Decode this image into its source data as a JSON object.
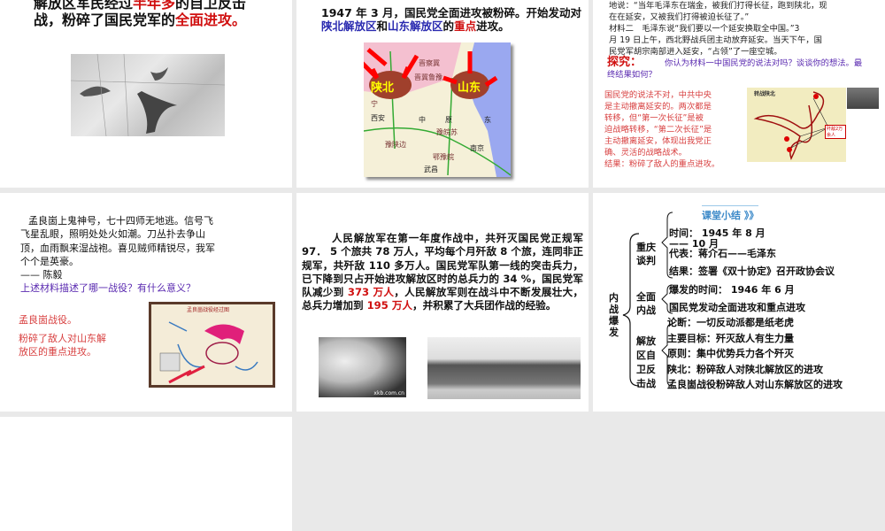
{
  "slides": [
    {
      "line1_a": "解放区军民经过",
      "line1_red": "半年多",
      "line1_b": "的自卫反击",
      "line2_a": "战，粉碎了国民党军的",
      "line2_red": "全面进攻。",
      "image": "war-map-grayscale"
    },
    {
      "line1": "1947 年 3 月，国民党全面进攻被粉碎。开始发动对",
      "p1": "陕北解放区",
      "p2": "和",
      "p3": "山东解放区",
      "p4": "的",
      "p5": "重点",
      "p6": "进攻。",
      "map_labels": {
        "shanbei": "陕北",
        "shandong": "山东",
        "jinchaji": "晋察冀",
        "jijiluyu": "晋冀鲁豫",
        "xian": "西安",
        "zhong": "中",
        "yuan": "原",
        "dong": "东",
        "yuwansu": "豫皖苏",
        "yushaanbian": "豫陕边",
        "eyuwan": "鄂豫皖",
        "nanjing": "南京",
        "wuchang": "武昌",
        "ning": "宁"
      }
    },
    {
      "lines": [
        "地说：“当年毛泽东在瑞金，被我们打得长征，跑到陕北，现",
        "在在延安，又被我们打得被迫长征了。”",
        "材料二　毛泽东说“我们要以一个延安换取全中国。”3",
        "月 19 日上午，西北野战兵团主动放弃延安。当天下午，国",
        "民党军胡宗南部进入延安，“占领”了一座空城。"
      ],
      "explore_label": "探究：",
      "question": "你认为材料一中国民党的说法对吗？谈谈你的想法。最终结果如何？",
      "answer": [
        "国民党的说法不对，中共中央",
        "是主动撤离延安的。两次都是",
        "转移，但“第一次长征”是被",
        "迫战略转移，“第二次长征”是",
        "主动撤离延安，体现出我党正",
        "确、灵活的战略战术。",
        "结果：粉碎了敌人的重点进攻。"
      ],
      "map_title": "转战陕北",
      "map_tag": "歼敌2万余人"
    },
    {
      "poem": [
        "孟良崮上鬼神号，七十四师无地逃。信号飞",
        "飞星乱眼，照明处处火如潮。刀丛扑去争山",
        "顶，血雨飘来湿战袍。喜见贼师精锐尽，我军",
        "个个是英豪。",
        "—— 陈毅"
      ],
      "question": "上述材料描述了哪一战役？有什么意义？",
      "answer1": "孟良崮战役。",
      "answer2": [
        "粉碎了敌人对山东解",
        "放区的重点进攻。"
      ],
      "map_title": "孟良崮战役经过图"
    },
    {
      "t1": "人民解放军在第一年度作战中，共歼灭国民党正规军 97． 5 个旅共 78 万人，平均每个月歼敌 8 个旅，连同非正规军，共歼敌 110 多万人。国民党军队第一线的突击兵力，已下降到只占开始进攻解放区时的总兵力的 34 %，国民党军队减少到 ",
      "r1": "373 万人",
      "t2": "，人民解放军则在战斗中不断发展壮大，总兵力增加到 ",
      "r2": "195 万人",
      "t3": "，并积累了大兵团作战的经验。",
      "watermark": "xkb.com.cn"
    },
    {
      "title": "课堂小结",
      "chev": "》》",
      "root": "内战爆发",
      "b1": "重庆谈判",
      "b1_items": [
        "时间： 1945 年 8 月—— 10 月",
        "代表：蒋介石——毛泽东",
        "结果：签署《双十协定》召开政协会议"
      ],
      "b2": "全面内战",
      "b2_items": [
        "爆发的时间： 1946 年 6 月",
        "国民党发动全面进攻和重点进攻"
      ],
      "b3": "解放区自卫反击战",
      "b3_items": [
        "论断：一切反动派都是纸老虎",
        "主要目标：歼灭敌人有生力量",
        "原则：集中优势兵力各个歼灭",
        "陕北：粉碎敌人对陕北解放区的进攻",
        "孟良崮战役粉碎敌人对山东解放区的进攻"
      ]
    }
  ]
}
